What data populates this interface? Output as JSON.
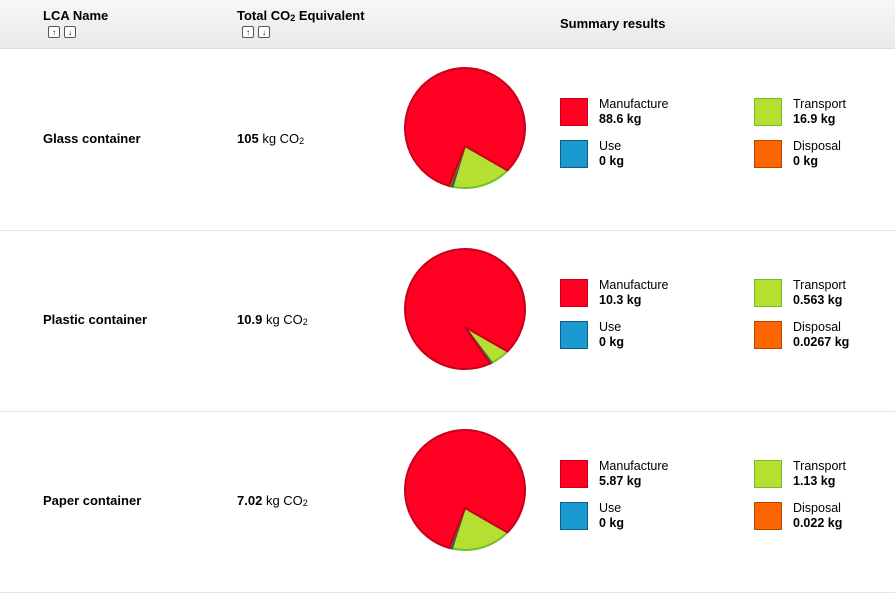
{
  "header": {
    "lca_name": "LCA Name",
    "total_prefix": "Total CO",
    "total_sub": "2",
    "total_suffix": " Equivalent",
    "summary": "Summary results",
    "sort_up": "↑",
    "sort_down": "↓"
  },
  "colors": {
    "manufacture": "#ff0022",
    "use": "#1b9ad1",
    "transport": "#b5e032",
    "disposal": "#ff6600"
  },
  "icons": [
    "sort-ascending-icon",
    "sort-descending-icon"
  ],
  "unit": {
    "prefix": "kg CO",
    "sub": "2"
  },
  "legend_labels": {
    "manufacture": "Manufacture",
    "use": "Use",
    "transport": "Transport",
    "disposal": "Disposal"
  },
  "rows": [
    {
      "name": "Glass container",
      "total": "105",
      "manufacture": "88.6 kg",
      "use": "0 kg",
      "transport": "16.9 kg",
      "disposal": "0 kg",
      "values": {
        "manufacture": 88.6,
        "use": 0.5,
        "transport": 16.9,
        "disposal": 0.6
      }
    },
    {
      "name": "Plastic container",
      "total": "10.9",
      "manufacture": "10.3 kg",
      "use": "0 kg",
      "transport": "0.563 kg",
      "disposal": "0.0267 kg",
      "values": {
        "manufacture": 10.3,
        "use": 0.03,
        "transport": 0.563,
        "disposal": 0.0267
      }
    },
    {
      "name": "Paper container",
      "total": "7.02",
      "manufacture": "5.87 kg",
      "use": "0 kg",
      "transport": "1.13 kg",
      "disposal": "0.022 kg",
      "values": {
        "manufacture": 5.87,
        "use": 0.03,
        "transport": 1.13,
        "disposal": 0.022
      }
    }
  ]
}
